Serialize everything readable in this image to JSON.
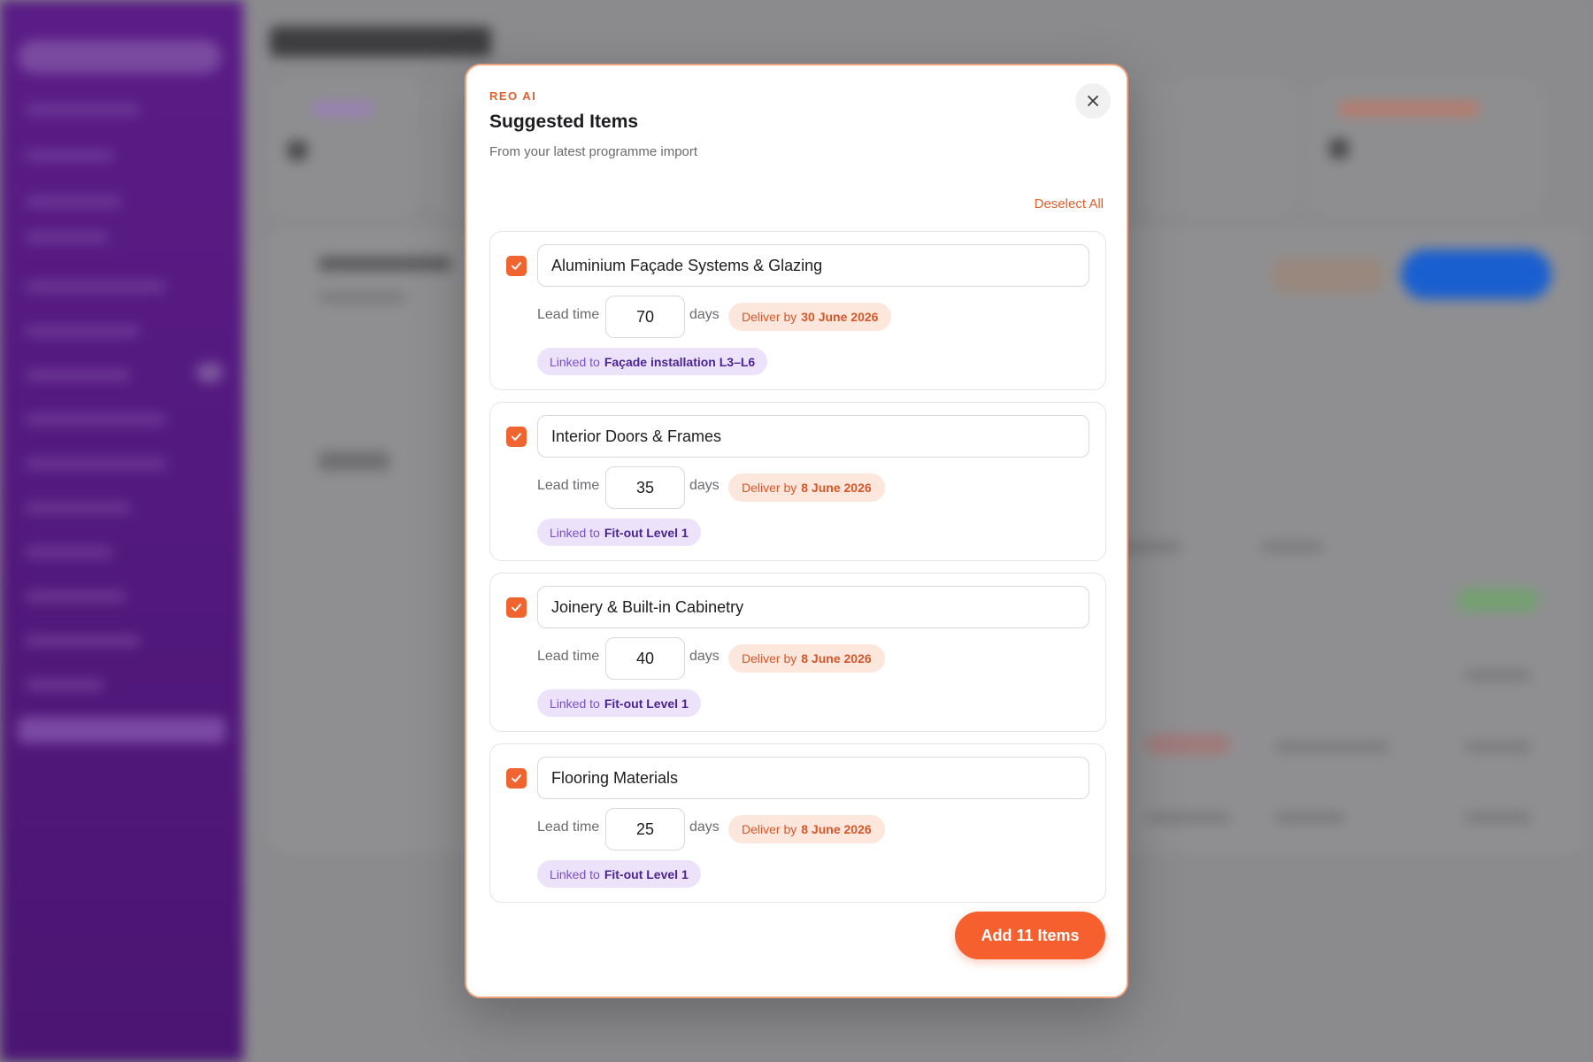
{
  "modal": {
    "eyebrow": "REO AI",
    "title": "Suggested Items",
    "subtitle": "From your latest programme import",
    "deselect_all": "Deselect All",
    "add_button": "Add 11 Items",
    "close_icon": "close-icon",
    "accent_color": "#f5602e"
  },
  "items": [
    {
      "checked": true,
      "name": "Aluminium Façade Systems & Glazing",
      "lead_time_label": "Lead time",
      "lead_time": "70",
      "days_label": "days",
      "deliver_prefix": "Deliver by",
      "deliver_date": "30 June 2026",
      "linked_prefix": "Linked to",
      "linked_task": "Façade installation L3–L6"
    },
    {
      "checked": true,
      "name": "Interior Doors & Frames",
      "lead_time_label": "Lead time",
      "lead_time": "35",
      "days_label": "days",
      "deliver_prefix": "Deliver by",
      "deliver_date": "8 June 2026",
      "linked_prefix": "Linked to",
      "linked_task": "Fit-out Level 1"
    },
    {
      "checked": true,
      "name": "Joinery & Built-in Cabinetry",
      "lead_time_label": "Lead time",
      "lead_time": "40",
      "days_label": "days",
      "deliver_prefix": "Deliver by",
      "deliver_date": "8 June 2026",
      "linked_prefix": "Linked to",
      "linked_task": "Fit-out Level 1"
    },
    {
      "checked": true,
      "name": "Flooring Materials",
      "lead_time_label": "Lead time",
      "lead_time": "25",
      "days_label": "days",
      "deliver_prefix": "Deliver by",
      "deliver_date": "8 June 2026",
      "linked_prefix": "Linked to",
      "linked_task": "Fit-out Level 1"
    }
  ]
}
